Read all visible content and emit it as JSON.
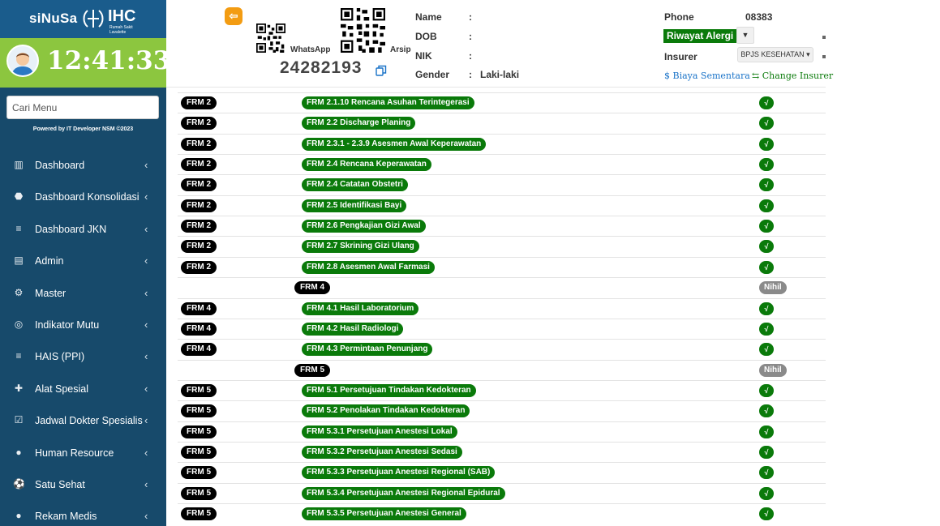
{
  "brand": {
    "name": "siNuSa",
    "logo": "IHC",
    "subtitle": "Rumah Sakit Lavalette"
  },
  "clock": "12:41:33",
  "menu_search": {
    "placeholder": "Cari Menu"
  },
  "powered_by": "Powered by IT Developer NSM ©2023",
  "nav": [
    {
      "label": "Dashboard",
      "icon": "bar-chart-icon"
    },
    {
      "label": "Dashboard Konsolidasi",
      "icon": "android-icon"
    },
    {
      "label": "Dashboard JKN",
      "icon": "list-icon"
    },
    {
      "label": "Admin",
      "icon": "server-icon"
    },
    {
      "label": "Master",
      "icon": "cogs-icon"
    },
    {
      "label": "Indikator Mutu",
      "icon": "target-icon"
    },
    {
      "label": "HAIS (PPI)",
      "icon": "list-icon"
    },
    {
      "label": "Alat Spesial",
      "icon": "puzzle-icon"
    },
    {
      "label": "Jadwal Dokter Spesialis",
      "icon": "calendar-check-icon"
    },
    {
      "label": "Human Resource",
      "icon": "users-icon"
    },
    {
      "label": "Satu Sehat",
      "icon": "soccer-ball-icon"
    },
    {
      "label": "Rekam Medis",
      "icon": "users-icon"
    }
  ],
  "header": {
    "whatsapp_label": "WhatsApp",
    "arsip_label": "Arsip",
    "rm_number": "24282193",
    "name_label": "Name",
    "dob_label": "DOB",
    "nik_label": "NIK",
    "gender_label": "Gender",
    "colon": ":",
    "name_value": "",
    "dob_value": "",
    "nik_value": "",
    "gender_value": "Laki-laki",
    "phone_label": "Phone",
    "phone_value": "08383",
    "allergy_button": "Riwayat Alergi",
    "insurer_label": "Insurer",
    "insurer_value": "BPJS KESEHATAN",
    "biaya_link": "Biaya Sementara",
    "change_insurer_link": "Change Insurer"
  },
  "rows": [
    {
      "type": "item",
      "code": "FRM 2",
      "form": "FRM 2.1.10 Rencana Asuhan Terintegerasi",
      "status": "√"
    },
    {
      "type": "item",
      "code": "FRM 2",
      "form": "FRM 2.2 Discharge Planing",
      "status": "√"
    },
    {
      "type": "item",
      "code": "FRM 2",
      "form": "FRM 2.3.1 - 2.3.9 Asesmen Awal Keperawatan",
      "status": "√"
    },
    {
      "type": "item",
      "code": "FRM 2",
      "form": "FRM 2.4 Rencana Keperawatan",
      "status": "√"
    },
    {
      "type": "item",
      "code": "FRM 2",
      "form": "FRM 2.4 Catatan Obstetri",
      "status": "√"
    },
    {
      "type": "item",
      "code": "FRM 2",
      "form": "FRM 2.5 Identifikasi Bayi",
      "status": "√"
    },
    {
      "type": "item",
      "code": "FRM 2",
      "form": "FRM 2.6 Pengkajian Gizi Awal",
      "status": "√"
    },
    {
      "type": "item",
      "code": "FRM 2",
      "form": "FRM 2.7 Skrining Gizi Ulang",
      "status": "√"
    },
    {
      "type": "item",
      "code": "FRM 2",
      "form": "FRM 2.8 Asesmen Awal Farmasi",
      "status": "√"
    },
    {
      "type": "group",
      "code": "FRM 4",
      "status": "Nihil"
    },
    {
      "type": "item",
      "code": "FRM 4",
      "form": "FRM 4.1 Hasil Laboratorium",
      "status": "√"
    },
    {
      "type": "item",
      "code": "FRM 4",
      "form": "FRM 4.2 Hasil Radiologi",
      "status": "√"
    },
    {
      "type": "item",
      "code": "FRM 4",
      "form": "FRM 4.3 Permintaan Penunjang",
      "status": "√"
    },
    {
      "type": "group",
      "code": "FRM 5",
      "status": "Nihil"
    },
    {
      "type": "item",
      "code": "FRM 5",
      "form": "FRM 5.1 Persetujuan Tindakan Kedokteran",
      "status": "√"
    },
    {
      "type": "item",
      "code": "FRM 5",
      "form": "FRM 5.2 Penolakan Tindakan Kedokteran",
      "status": "√"
    },
    {
      "type": "item",
      "code": "FRM 5",
      "form": "FRM 5.3.1 Persetujuan Anestesi Lokal",
      "status": "√"
    },
    {
      "type": "item",
      "code": "FRM 5",
      "form": "FRM 5.3.2 Persetujuan Anestesi Sedasi",
      "status": "√"
    },
    {
      "type": "item",
      "code": "FRM 5",
      "form": "FRM 5.3.3 Persetujuan Anestesi Regional (SAB)",
      "status": "√"
    },
    {
      "type": "item",
      "code": "FRM 5",
      "form": "FRM 5.3.4 Persetujuan Anestesi Regional Epidural",
      "status": "√"
    },
    {
      "type": "item",
      "code": "FRM 5",
      "form": "FRM 5.3.5 Persetujuan Anestesi General",
      "status": "√"
    }
  ],
  "colors": {
    "sidebar": "#174a6b",
    "brand": "#1a5c8c",
    "clockbar": "#8cc63f",
    "form_pill": "#0a7a0a",
    "code_pill": "#000000",
    "nihil": "#8a8a8a",
    "back_button": "#f39c12"
  }
}
